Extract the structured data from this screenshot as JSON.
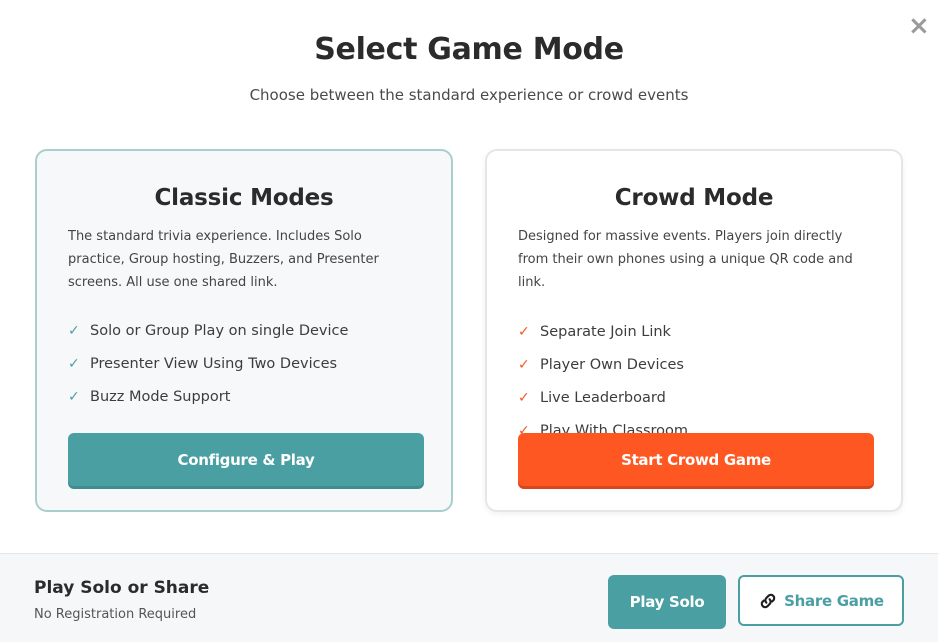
{
  "modal": {
    "title": "Select Game Mode",
    "subtitle": "Choose between the standard experience or crowd events",
    "close_icon": "×"
  },
  "classic": {
    "title": "Classic Modes",
    "description": "The standard trivia experience. Includes Solo practice, Group hosting, Buzzers, and Presenter screens. All use one shared link.",
    "features": [
      "Solo or Group Play on single Device",
      "Presenter View Using Two Devices",
      "Buzz Mode Support"
    ],
    "button_label": "Configure & Play"
  },
  "crowd": {
    "title": "Crowd Mode",
    "description": "Designed for massive events. Players join directly from their own phones using a unique QR code and link.",
    "features": [
      "Separate Join Link",
      "Player Own Devices",
      "Live Leaderboard",
      "Play With Classroom"
    ],
    "button_label": "Start Crowd Game"
  },
  "footer": {
    "title": "Play Solo or Share",
    "subtitle": "No Registration Required",
    "play_solo_label": "Play Solo",
    "share_label": "Share Game"
  },
  "icons": {
    "check": "✓",
    "close": "close-icon",
    "link": "link-icon"
  },
  "colors": {
    "teal": "#4a9fa3",
    "orange": "#ff5722"
  }
}
